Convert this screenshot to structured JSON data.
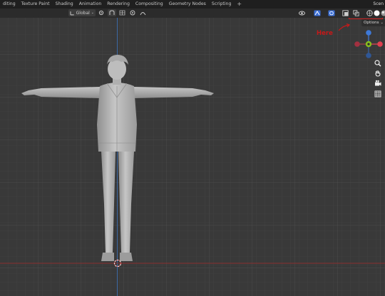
{
  "topbar": {
    "tabs": [
      "diting",
      "Texture Paint",
      "Shading",
      "Animation",
      "Rendering",
      "Compositing",
      "Geometry Nodes",
      "Scripting",
      "+"
    ],
    "scene_label": "Scen"
  },
  "header": {
    "orientation": "Global"
  },
  "annotation": {
    "label": "Here",
    "color": "#c81818"
  },
  "viewport": {
    "options_label": "Options"
  },
  "gizmo": {
    "axes": [
      {
        "name": "x-axis",
        "color": "#e04050"
      },
      {
        "name": "y-axis",
        "color": "#86bc1e"
      },
      {
        "name": "z-axis",
        "color": "#3e79d8"
      }
    ]
  },
  "icons": [
    "view-icon",
    "selectability-icon",
    "gizmo-icon",
    "overlay-icon",
    "xray-icon",
    "wireframe-shading-icon",
    "solid-shading-icon",
    "material-shading-icon",
    "rendered-shading-icon",
    "zoom-icon",
    "hand-pan-icon",
    "camera-icon",
    "grid-icon"
  ]
}
